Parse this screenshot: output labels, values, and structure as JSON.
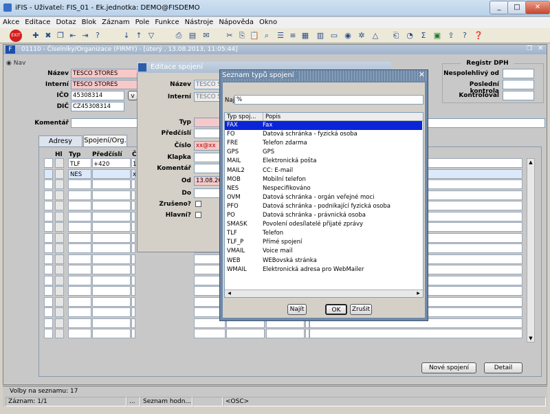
{
  "window": {
    "title": "iFIS - Uživatel: FIS_01 - Ek.jednotka: DEMO@FISDEMO"
  },
  "menu": [
    "Akce",
    "Editace",
    "Dotaz",
    "Blok",
    "Záznam",
    "Pole",
    "Funkce",
    "Nástroje",
    "Nápověda",
    "Okno"
  ],
  "toolbar": {
    "exit_label": "EXIT"
  },
  "document": {
    "title": "01110 - Číselníky/Organizace (FIRMY) - [úterý , 13.08.2013, 11:05:44]",
    "nav_label": "Nav"
  },
  "form": {
    "nazev_label": "Název",
    "nazev_value": "TESCO STORES",
    "interni_label": "Interní",
    "interni_value": "TESCO STORES",
    "ico_label": "IČO",
    "ico_value": "45308314",
    "dic_label": "DIČ",
    "dic_value": "CZ45308314",
    "komentar_label": "Komentář",
    "registr_title": "Registr DPH",
    "nespolehlivy_label": "Nespolehlivý od",
    "posledni_label": "Poslední kontrola",
    "kontroloval_label": "Kontroloval"
  },
  "tabs": [
    "Adresy",
    "Spojení/Org."
  ],
  "grid": {
    "headers": [
      "Hl",
      "Typ",
      "Předčíslí",
      "Č"
    ],
    "rows": [
      {
        "typ": "TLF",
        "predcisli": "+420",
        "c": "1"
      },
      {
        "typ": "NES",
        "predcisli": "",
        "c": "x"
      }
    ]
  },
  "buttons": {
    "nove_spojeni": "Nové spojení",
    "detail": "Detail"
  },
  "edit_dialog": {
    "title": "Editace spojení",
    "nazev_label": "Název",
    "nazev_value": "TESCO S",
    "interni_label": "Interní",
    "interni_value": "TESCO S",
    "typ_label": "Typ",
    "predcisli_label": "Předčíslí",
    "cislo_label": "Číslo",
    "cislo_value": "xx@xx",
    "klapka_label": "Klapka",
    "komentar_label": "Komentář",
    "od_label": "Od",
    "od_value": "13.08.201",
    "do_label": "Do",
    "zruseno_label": "Zrušeno?",
    "hlavni_label": "Hlavní?"
  },
  "lov": {
    "title": "Seznam typů spojení",
    "najit_label": "Najít",
    "search_value": "%",
    "col_code": "Typ spoj...",
    "col_desc": "Popis",
    "items": [
      {
        "code": "FAX",
        "desc": "Fax"
      },
      {
        "code": "FO",
        "desc": "Datová schránka - fyzická osoba"
      },
      {
        "code": "FRE",
        "desc": "Telefon zdarma"
      },
      {
        "code": "GPS",
        "desc": "GPS"
      },
      {
        "code": "MAIL",
        "desc": "Elektronická pošta"
      },
      {
        "code": "MAIL2",
        "desc": "CC: E-mail"
      },
      {
        "code": "MOB",
        "desc": "Mobilní telefon"
      },
      {
        "code": "NES",
        "desc": "Nespecifikováno"
      },
      {
        "code": "OVM",
        "desc": "Datová schránka - orgán veřejné moci"
      },
      {
        "code": "PFO",
        "desc": "Datová schránka - podnikající fyzická osoba"
      },
      {
        "code": "PO",
        "desc": "Datová schránka - právnická osoba"
      },
      {
        "code": "SMASK",
        "desc": "Povolení odesílatelé přijaté zprávy"
      },
      {
        "code": "TLF",
        "desc": "Telefon"
      },
      {
        "code": "TLF_P",
        "desc": "Přímé spojení"
      },
      {
        "code": "VMAIL",
        "desc": "Voice mail"
      },
      {
        "code": "WEB",
        "desc": "WEBovská stránka"
      },
      {
        "code": "WMAIL",
        "desc": "Elektronická adresa pro WebMailer"
      }
    ],
    "btn_najit": "Najít",
    "btn_ok": "OK",
    "btn_zrusit": "Zrušit"
  },
  "status": {
    "line": "Volby na seznamu: 17",
    "record": "Záznam: 1/1",
    "dots": "...",
    "hint": "Seznam hodn...",
    "osc": "<OSC>"
  }
}
